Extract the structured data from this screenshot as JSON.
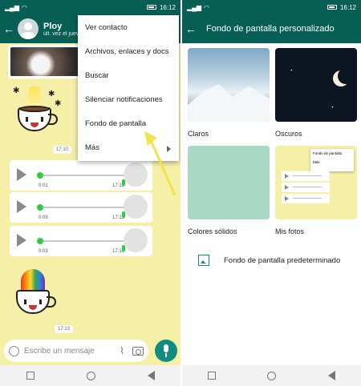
{
  "status": {
    "time": "16:12"
  },
  "chat": {
    "contact_name": "Ploy",
    "contact_status": "últ. vez el jueves",
    "stickers_time": [
      "17:10",
      "17:13"
    ],
    "voice_notes": [
      {
        "duration": "0:01",
        "time": "17:11"
      },
      {
        "duration": "0:09",
        "time": "17:11"
      },
      {
        "duration": "0:03",
        "time": "17:13"
      }
    ],
    "input_placeholder": "Escribe un mensaje"
  },
  "menu": {
    "items": [
      "Ver contacto",
      "Archivos, enlaces y docs",
      "Buscar",
      "Silenciar notificaciones",
      "Fondo de pantalla",
      "Más"
    ]
  },
  "wallpaper": {
    "title": "Fondo de pantalla personalizado",
    "categories": [
      "Claros",
      "Oscuros",
      "Colores sólidos",
      "Mis fotos"
    ],
    "mini_menu": [
      "Fondo de pantalla",
      "Más"
    ],
    "default_label": "Fondo de pantalla predeterminado"
  },
  "colors": {
    "header": "#075e54",
    "accent": "#128c7e",
    "chat_bg": "#f6efa8",
    "arrow": "#f2e34b"
  },
  "icons": [
    "back-arrow-icon",
    "signal-icon",
    "wifi-icon",
    "battery-icon",
    "play-icon",
    "mic-icon",
    "emoji-icon",
    "attach-icon",
    "camera-icon",
    "image-icon",
    "chevron-right-icon",
    "moon-icon"
  ]
}
